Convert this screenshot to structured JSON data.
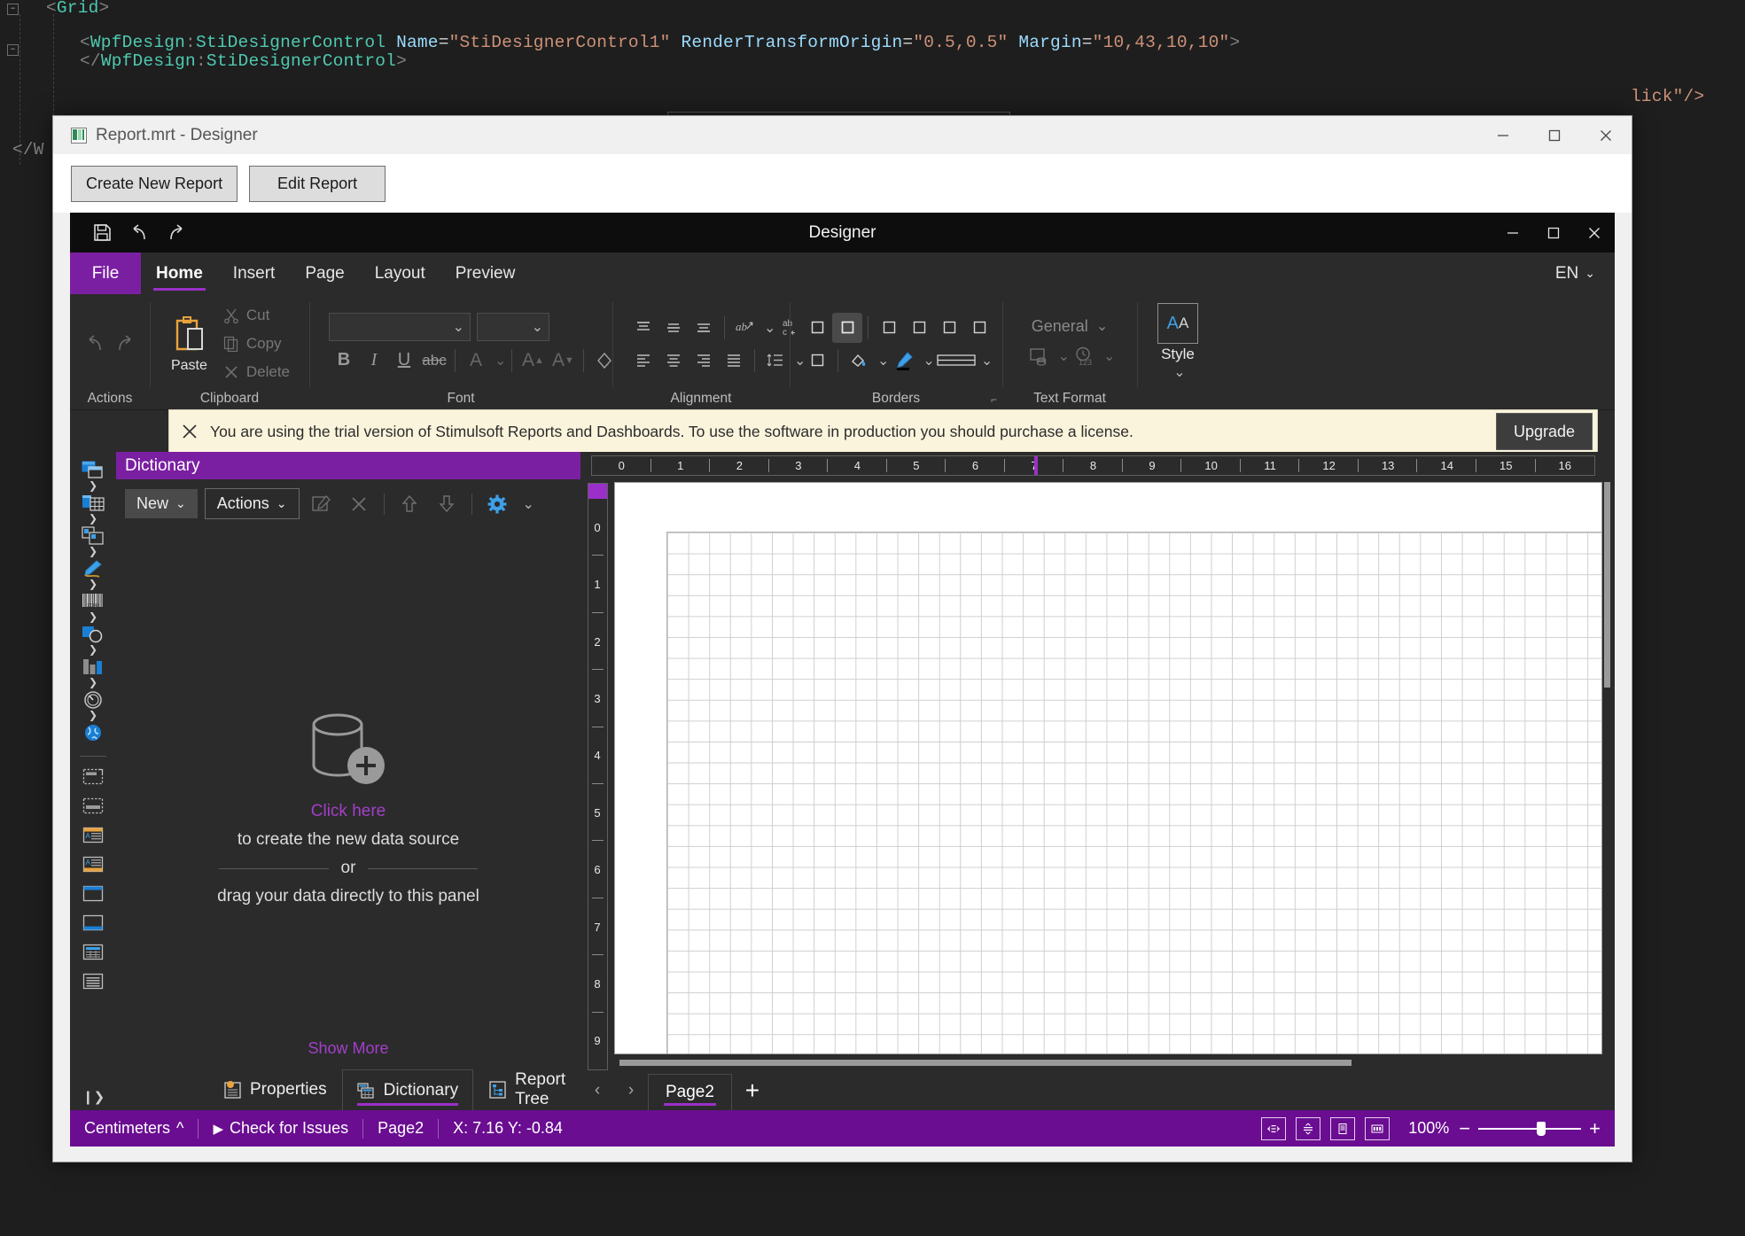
{
  "editor": {
    "lines": [
      {
        "indent": 0,
        "segments": [
          {
            "t": "<",
            "c": "tag"
          },
          {
            "t": "Grid",
            "c": "el"
          },
          {
            "t": ">",
            "c": "tag"
          }
        ]
      },
      {
        "indent": 1,
        "segments": [
          {
            "t": "<",
            "c": "tag"
          },
          {
            "t": "WpfDesign",
            "c": "ns"
          },
          {
            "t": ":",
            "c": "pun"
          },
          {
            "t": "StiDesignerControl",
            "c": "el"
          },
          {
            "t": " ",
            "c": "plain"
          },
          {
            "t": "Name",
            "c": "attr"
          },
          {
            "t": "=",
            "c": "eq"
          },
          {
            "t": "\"StiDesignerControl1\"",
            "c": "str"
          },
          {
            "t": " ",
            "c": "plain"
          },
          {
            "t": "RenderTransformOrigin",
            "c": "attr"
          },
          {
            "t": "=",
            "c": "eq"
          },
          {
            "t": "\"0.5,0.5\"",
            "c": "str"
          },
          {
            "t": " ",
            "c": "plain"
          },
          {
            "t": "Margin",
            "c": "attr"
          },
          {
            "t": "=",
            "c": "eq"
          },
          {
            "t": "\"10,43,10,10\"",
            "c": "str"
          },
          {
            "t": ">",
            "c": "tag"
          }
        ]
      },
      {
        "indent": 1,
        "segments": [
          {
            "t": "</",
            "c": "tag"
          },
          {
            "t": "WpfDesign",
            "c": "ns"
          },
          {
            "t": ":",
            "c": "pun"
          },
          {
            "t": "StiDesignerControl",
            "c": "el"
          },
          {
            "t": ">",
            "c": "tag"
          }
        ]
      }
    ],
    "closing_tag": "</W",
    "right_fragment": "lick\"/>"
  },
  "vs_overlay": {
    "icons": [
      "select-element-icon",
      "record-icon",
      "pointer-window-icon",
      "frame-icon",
      "pointer-frame-icon",
      "xaml-hot-reload-icon",
      "accessibility-icon",
      "status-ok-icon",
      "collapse-chevron-icon"
    ]
  },
  "app_window": {
    "title": "Report.mrt - Designer",
    "icon": "report-document-icon",
    "controls": {
      "minimize": "minimize-icon",
      "maximize": "maximize-icon",
      "close": "close-icon"
    },
    "buttons": [
      {
        "label": "Create New Report",
        "name": "create-new-report-button"
      },
      {
        "label": "Edit Report",
        "name": "edit-report-button"
      }
    ]
  },
  "designer": {
    "title": "Designer",
    "quick_access": [
      "save-icon",
      "undo-icon",
      "redo-icon"
    ],
    "window_controls": [
      "minimize-icon",
      "maximize-icon",
      "close-icon"
    ],
    "language": "EN",
    "tabs": [
      {
        "label": "File",
        "active": false,
        "special": true
      },
      {
        "label": "Home",
        "active": true
      },
      {
        "label": "Insert",
        "active": false
      },
      {
        "label": "Page",
        "active": false
      },
      {
        "label": "Layout",
        "active": false
      },
      {
        "label": "Preview",
        "active": false
      }
    ],
    "ribbon_groups": [
      {
        "label": "Actions",
        "name": "ribbon-group-actions"
      },
      {
        "label": "Clipboard",
        "name": "ribbon-group-clipboard",
        "paste": "Paste",
        "cut": "Cut",
        "copy": "Copy",
        "delete": "Delete"
      },
      {
        "label": "Font",
        "name": "ribbon-group-font",
        "font_family": "",
        "font_size": ""
      },
      {
        "label": "Alignment",
        "name": "ribbon-group-alignment"
      },
      {
        "label": "Borders",
        "name": "ribbon-group-borders"
      },
      {
        "label": "Text Format",
        "name": "ribbon-group-text-format",
        "format_value": "General"
      }
    ],
    "style": {
      "label": "Style",
      "glyph_a": "A",
      "glyph_b": "A"
    }
  },
  "trial_banner": {
    "close_icon": "close-icon",
    "message": "You are using the trial version of Stimulsoft Reports and Dashboards. To use the software in production you should purchase a license.",
    "upgrade_label": "Upgrade"
  },
  "tool_rail": {
    "items": [
      {
        "name": "rail-item-pages",
        "icon": "pages-icon",
        "expandable": true
      },
      {
        "name": "rail-item-data",
        "icon": "data-table-icon",
        "expandable": true
      },
      {
        "name": "rail-item-cross-tab",
        "icon": "cross-tab-icon",
        "expandable": true
      },
      {
        "name": "rail-item-shape",
        "icon": "pen-shape-icon",
        "expandable": true
      },
      {
        "name": "rail-item-barcode",
        "icon": "barcode-icon",
        "expandable": true
      },
      {
        "name": "rail-item-primitives",
        "icon": "shapes-icon",
        "expandable": true
      },
      {
        "name": "rail-item-chart",
        "icon": "chart-bar-icon",
        "expandable": true
      },
      {
        "name": "rail-item-gauge",
        "icon": "gauge-icon",
        "expandable": true
      },
      {
        "name": "rail-item-map",
        "icon": "globe-map-icon",
        "expandable": false
      }
    ],
    "bands": [
      {
        "name": "rail-band-report-title",
        "icon": "band-report-title-icon"
      },
      {
        "name": "rail-band-report-summary",
        "icon": "band-report-summary-icon"
      },
      {
        "name": "rail-band-page-header",
        "icon": "band-page-header-icon"
      },
      {
        "name": "rail-band-page-footer",
        "icon": "band-page-footer-icon"
      },
      {
        "name": "rail-band-header",
        "icon": "band-header-icon"
      },
      {
        "name": "rail-band-footer",
        "icon": "band-footer-icon"
      },
      {
        "name": "rail-band-data",
        "icon": "band-data-icon"
      },
      {
        "name": "rail-band-text",
        "icon": "band-text-icon"
      }
    ],
    "expand_icon": "expand-panel-icon"
  },
  "dictionary": {
    "title": "Dictionary",
    "toolbar": {
      "new_label": "New",
      "actions_label": "Actions",
      "icons": [
        "edit-icon",
        "delete-icon",
        "move-up-icon",
        "move-down-icon",
        "settings-gear-icon"
      ]
    },
    "empty": {
      "icon": "database-add-icon",
      "click_here": "Click here",
      "line1": "to create the new data source",
      "or": "or",
      "line2": "drag your data directly to this panel"
    },
    "show_more": "Show More"
  },
  "dock_tabs": [
    {
      "label": "Properties",
      "icon": "properties-icon",
      "active": false,
      "name": "tab-properties"
    },
    {
      "label": "Dictionary",
      "icon": "dictionary-icon",
      "active": true,
      "name": "tab-dictionary"
    },
    {
      "label": "Report Tree",
      "icon": "report-tree-icon",
      "active": false,
      "name": "tab-report-tree"
    }
  ],
  "canvas": {
    "h_ruler": [
      "0",
      "1",
      "2",
      "3",
      "4",
      "5",
      "6",
      "7",
      "8",
      "9",
      "10",
      "11",
      "12",
      "13",
      "14",
      "15",
      "16"
    ],
    "v_ruler": [
      "0",
      "1",
      "2",
      "3",
      "4",
      "5",
      "6",
      "7",
      "8",
      "9"
    ],
    "h_cursor_at": "7",
    "page_tabs": {
      "prev_icon": "chevron-left-icon",
      "next_icon": "chevron-right-icon",
      "tabs": [
        {
          "label": "Page2",
          "active": true,
          "name": "page-tab-page2"
        }
      ],
      "add_label": "+"
    }
  },
  "status_bar": {
    "units": "Centimeters",
    "units_caret": "^",
    "check_issues": "Check for Issues",
    "page": "Page2",
    "coords": "X: 7.16 Y: -0.84",
    "view_buttons": [
      "view-horizontal-icon",
      "view-vertical-icon",
      "view-single-page-icon",
      "view-thumbnails-icon"
    ],
    "zoom_value": "100%",
    "zoom_minus": "−",
    "zoom_plus": "+"
  }
}
